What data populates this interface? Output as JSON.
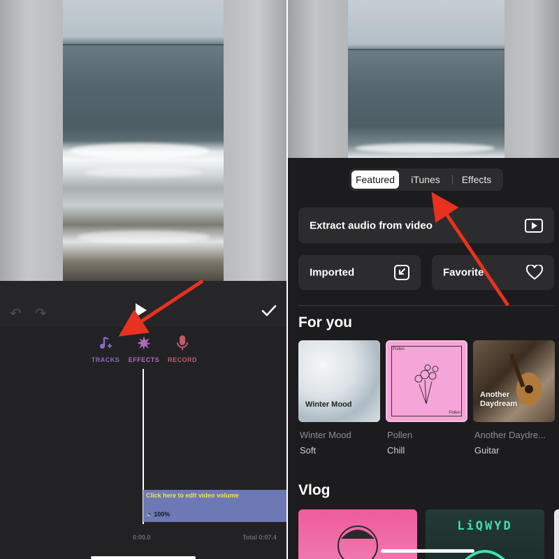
{
  "left_panel": {
    "tools": [
      {
        "label": "TRACKS",
        "icon": "music-note-plus-icon",
        "color": "#8a68c6"
      },
      {
        "label": "EFFECTS",
        "icon": "sparkle-icon",
        "color": "#b06ac0"
      },
      {
        "label": "RECORD",
        "icon": "microphone-icon",
        "color": "#c05a68"
      }
    ],
    "volume_strip": {
      "title": "Click here to edit video volume",
      "percent": "100%"
    },
    "timeline": {
      "start": "0:00.0",
      "total": "Total 0:07.4"
    }
  },
  "right_panel": {
    "tabs": [
      {
        "label": "Featured",
        "selected": true
      },
      {
        "label": "iTunes",
        "selected": false
      },
      {
        "label": "Effects",
        "selected": false
      }
    ],
    "extract_audio": "Extract audio from video",
    "imported": "Imported",
    "favorite": "Favorite",
    "for_you": {
      "title": "For you",
      "albums": [
        {
          "cover_label": "Winter Mood",
          "title": "Winter Mood",
          "genre": "Soft"
        },
        {
          "cover_label": "Pollen",
          "cover_label_2": "Pollen",
          "title": "Pollen",
          "genre": "Chill"
        },
        {
          "cover_label": "Another Daydream",
          "title": "Another Daydre...",
          "genre": "Guitar"
        }
      ]
    },
    "vlog": {
      "title": "Vlog",
      "cards": [
        "",
        "LiQWYD",
        ""
      ]
    }
  },
  "colors": {
    "accent_arrow": "#e8321f",
    "background_dark": "#1c1c1e",
    "card_bg": "#2c2c2e"
  }
}
